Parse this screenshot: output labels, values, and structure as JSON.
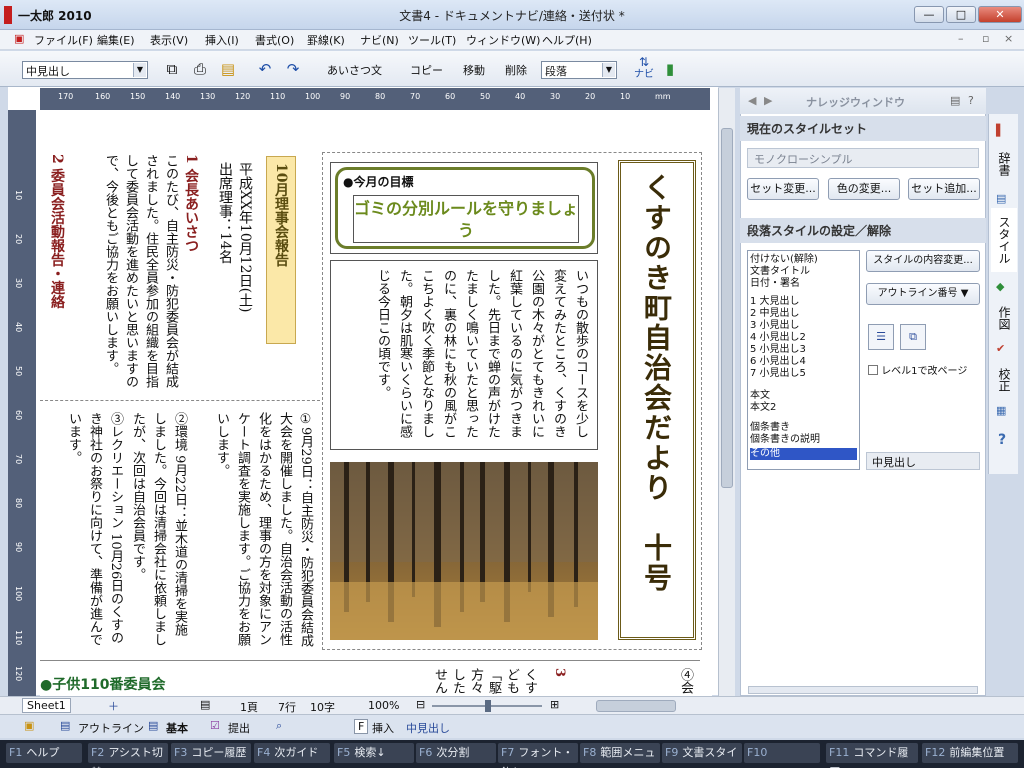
{
  "app": {
    "name": "一太郎 2010",
    "title": "文書4 - ドキュメントナビ/連絡・送付状 *"
  },
  "window_buttons": {
    "min": "—",
    "max": "□",
    "close": "✕"
  },
  "menu": [
    "ファイル(F)",
    "編集(E)",
    "表示(V)",
    "挿入(I)",
    "書式(O)",
    "罫線(K)",
    "ナビ(N)",
    "ツール(T)",
    "ウィンドウ(W)",
    "ヘルプ(H)"
  ],
  "toolbar": {
    "style_value": "中見出し",
    "greeting": "あいさつ文",
    "copy": "コピー",
    "move": "移動",
    "delete": "削除",
    "para_value": "段落",
    "navi": "ナビ"
  },
  "ruler": {
    "h_ticks": [
      "170",
      "160",
      "150",
      "140",
      "130",
      "120",
      "110",
      "100",
      "90",
      "80",
      "70",
      "60",
      "50",
      "40",
      "30",
      "20",
      "10"
    ],
    "h_unit": "mm",
    "v_ticks": [
      "10",
      "20",
      "30",
      "40",
      "50",
      "60",
      "70",
      "80",
      "90",
      "100",
      "110",
      "120",
      "130"
    ]
  },
  "doc": {
    "masthead": "くすのき町自治会だより　十号",
    "goal_label": "●今月の目標",
    "goal_text": "ゴミの分別ルールを守りましょう",
    "essay": "いつもの散歩のコースを少し変えてみたところ、くすのき公園の木々がとてもきれいに紅葉しているのに気がつきました。先日まで蝉の声がけたたましく鳴いていたと思ったのに、裏の林にも秋の風がここちよく吹く季節となりました。朝夕は肌寒いくらいに感じる今日この頃です。",
    "report_title": "10月理事会報告",
    "report_date": "平成XX年10月12日(土)",
    "report_attend": "出席理事：14名",
    "greeting_head": "1 会長あいさつ",
    "greeting_body": "このたび、自主防災・防犯委員会が結成されました。住民全員参加の組織を目指して委員会活動を進めたいと思いますので、今後ともご協力をお願いします。",
    "committee_head": "2 委員会活動報告・連絡",
    "item1": "①9月29日：自主防災・防犯委員会結成大会を開催しました。自治会活動の活性化をはかるため、理事の方を対象にアンケート調査を実施します。ご協力をお願いします。",
    "item2": "②環境 9月22日：並木道の清掃を実施しました。今回は清掃会社に依頼しましたが、次回は自治会員です。",
    "item3": "③レクリエーション 10月26日のくすのき神社のお祭りに向けて、準備が進んでいます。",
    "section_footer": "●子供110番委員会",
    "frag": [
      "くす",
      "ども",
      "「駆",
      "方々",
      "した",
      "せん"
    ],
    "frag3": "3",
    "frag4": "④会"
  },
  "knowledge": {
    "title": "ナレッジウィンドウ",
    "section1": "現在のスタイルセット",
    "styleset": "モノクローシンプル",
    "btn_set": "セット変更...",
    "btn_color": "色の変更...",
    "btn_add": "セット追加...",
    "section2": "段落スタイルの設定／解除",
    "styles": [
      "付けない(解除)",
      "文書タイトル",
      "日付・署名",
      "1 大見出し",
      "2 中見出し",
      "3 小見出し",
      "4 小見出し2",
      "5 小見出し3",
      "6 小見出し4",
      "7 小見出し5",
      "本文",
      "本文2",
      "個条書き",
      "個条書きの説明",
      "その他"
    ],
    "btn_change": "スタイルの内容変更...",
    "btn_outline": "アウトライン番号 ▼",
    "level_check": "レベル1で改ページ",
    "current_style": "中見出し"
  },
  "sidetabs": [
    "辞書",
    "スタイル",
    "作図",
    "校正"
  ],
  "status": {
    "sheet": "Sheet1",
    "page": "1頁",
    "line": "7行",
    "col": "10字",
    "zoom": "100%"
  },
  "modebar": {
    "outline": "アウトライン",
    "basic": "基本",
    "submit": "提出",
    "key": "F",
    "insert": "挿入",
    "style": "中見出し"
  },
  "fkeys": [
    {
      "k": "F1",
      "t": "ヘルプ"
    },
    {
      "k": "F2",
      "t": "アシスト切替"
    },
    {
      "k": "F3",
      "t": "コピー履歴"
    },
    {
      "k": "F4",
      "t": "次ガイド"
    },
    {
      "k": "F5",
      "t": "検索↓"
    },
    {
      "k": "F6",
      "t": "次分割"
    },
    {
      "k": "F7",
      "t": "フォント・飾り"
    },
    {
      "k": "F8",
      "t": "範囲メニュー"
    },
    {
      "k": "F9",
      "t": "文書スタイル"
    },
    {
      "k": "F10",
      "t": ""
    },
    {
      "k": "F11",
      "t": "コマンド履歴"
    },
    {
      "k": "F12",
      "t": "前編集位置"
    }
  ],
  "colors": {
    "accent": "#6b7d2a",
    "heading": "#8a1f1f",
    "selection": "#2f56c6"
  }
}
